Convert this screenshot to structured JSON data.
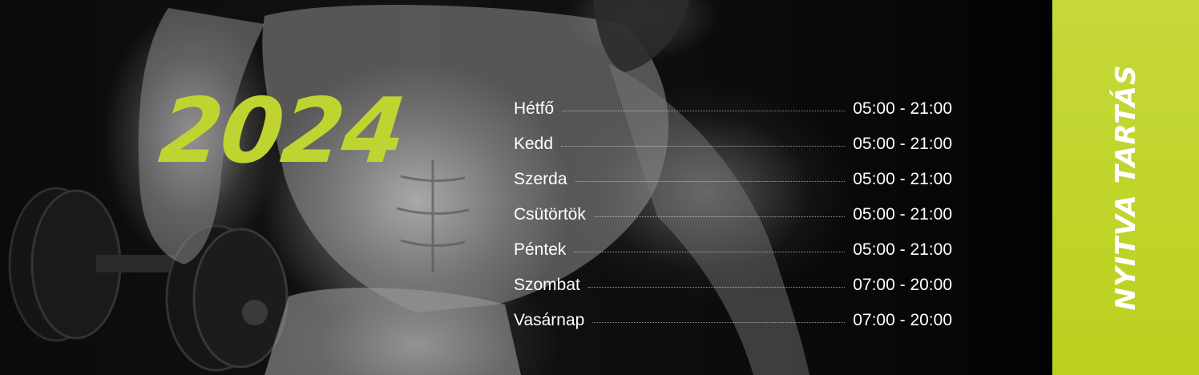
{
  "banner": {
    "year": "2024",
    "side_title": "NYITVA TARTÁS",
    "accent_color": "#bfd430"
  },
  "schedule": [
    {
      "day": "Hétfő",
      "hours": "05:00 - 21:00"
    },
    {
      "day": "Kedd",
      "hours": "05:00 - 21:00"
    },
    {
      "day": "Szerda",
      "hours": "05:00 - 21:00"
    },
    {
      "day": "Csütörtök",
      "hours": "05:00 - 21:00"
    },
    {
      "day": "Péntek",
      "hours": "05:00 - 21:00"
    },
    {
      "day": "Szombat",
      "hours": "07:00 - 20:00"
    },
    {
      "day": "Vasárnap",
      "hours": "07:00 - 20:00"
    }
  ],
  "photo": {
    "subject": "bodybuilder-with-dumbbell-icon"
  }
}
